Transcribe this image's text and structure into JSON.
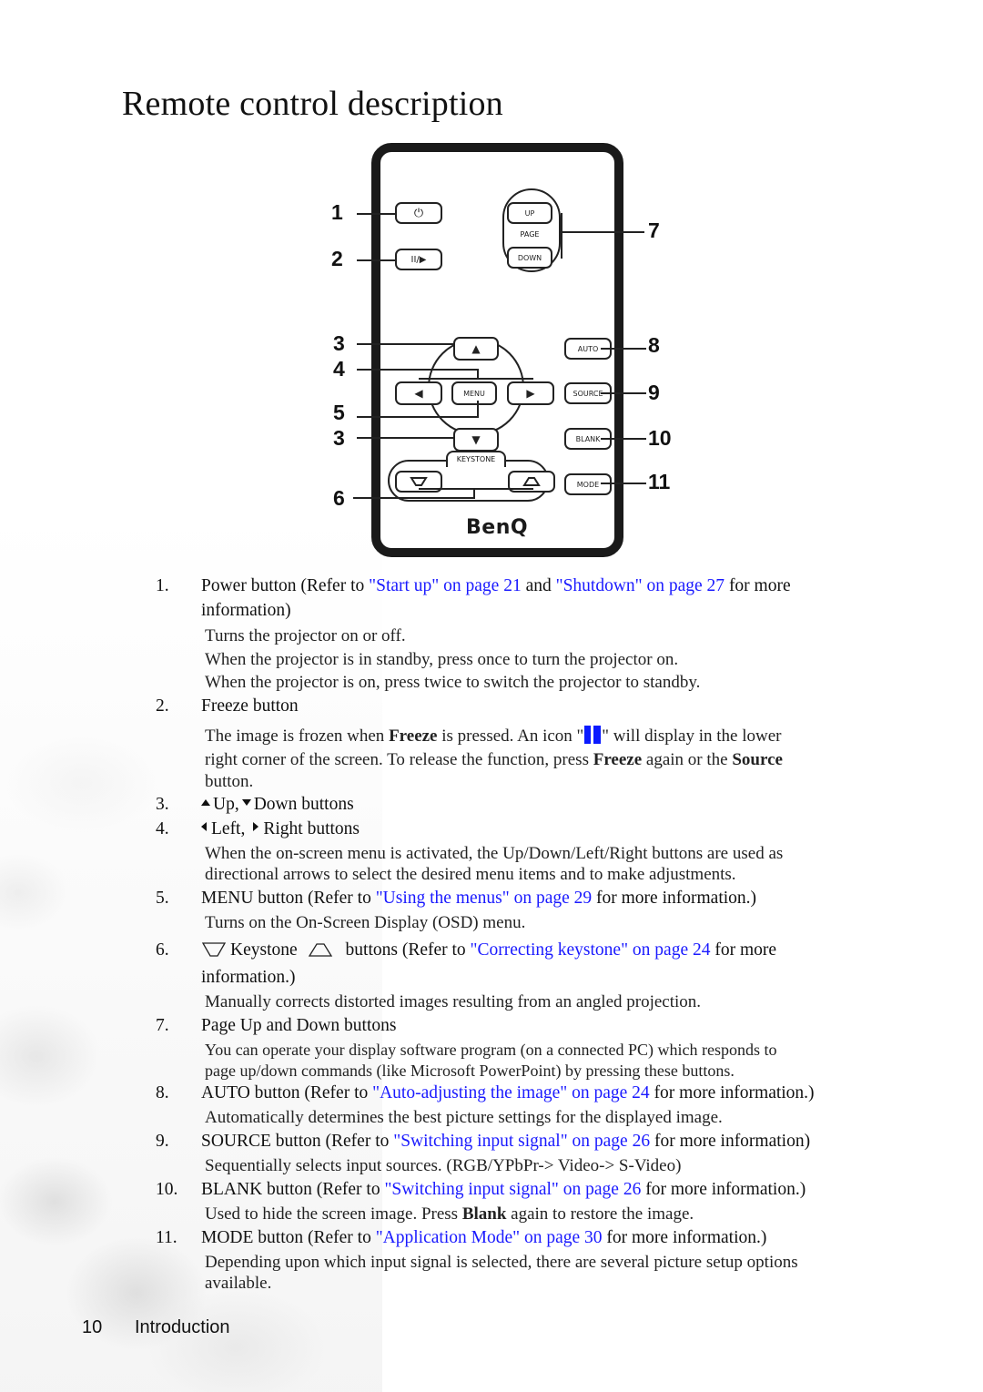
{
  "page": {
    "title": "Remote control description",
    "footer": {
      "page_number": "10",
      "section": "Introduction"
    }
  },
  "remote": {
    "brand": "BenQ",
    "buttons": {
      "power": "⏻",
      "freeze": "II/▶",
      "page_up": "UP",
      "page_label": "PAGE",
      "page_down": "DOWN",
      "up": "▲",
      "down": "▼",
      "left": "◀",
      "right": "▶",
      "menu": "MENU",
      "auto": "AUTO",
      "source": "SOURCE",
      "blank": "BLANK",
      "mode": "MODE",
      "keystone_label": "KEYSTONE"
    },
    "callouts": [
      "1",
      "2",
      "3",
      "4",
      "5",
      "3",
      "6",
      "7",
      "8",
      "9",
      "10",
      "11"
    ]
  },
  "items": [
    {
      "num": "1.",
      "title_pre": "Power button  (Refer to ",
      "link1": "\"Start up\" on page 21",
      "mid": " and ",
      "link2": "\"Shutdown\" on page 27",
      "title_post": " for more",
      "title_cont": "information)",
      "lines": [
        "Turns the projector on or off.",
        "When the projector is in standby, press once to turn the projector on.",
        "When the projector is on, press twice to switch the projector to standby."
      ]
    },
    {
      "num": "2.",
      "title": "Freeze button",
      "line1_pre": "The image is frozen when ",
      "line1_bold": "Freeze",
      "line1_mid": " is pressed. An icon \"",
      "line1_post": "\" will display in the lower",
      "line2_pre": "right corner of the screen. To release the function, press ",
      "line2_bold1": "Freeze",
      "line2_mid": " again or the ",
      "line2_bold2": "Source",
      "line3": "button."
    },
    {
      "num": "3.",
      "up": "Up,",
      "down": "Down buttons"
    },
    {
      "num": "4.",
      "left": "Left,",
      "right": "Right buttons",
      "lines": [
        "When the on-screen menu is activated, the Up/Down/Left/Right buttons are used as",
        "directional arrows to select the desired menu items and to make adjustments."
      ]
    },
    {
      "num": "5.",
      "title_pre": "MENU button (Refer to ",
      "link": "\"Using the menus\" on page 29",
      "title_post": " for more information.)",
      "lines": [
        "Turns on the On-Screen Display (OSD) menu."
      ]
    },
    {
      "num": "6.",
      "keystone": "Keystone",
      "title_pre": "buttons (Refer to ",
      "link": "\"Correcting keystone\" on page 24",
      "title_post": " for more",
      "title_cont": "information.)",
      "lines": [
        "Manually corrects distorted images resulting from an angled projection."
      ]
    },
    {
      "num": "7.",
      "title": "Page Up and Down buttons",
      "lines": [
        "You can operate your display software program (on a connected PC) which responds to",
        "page up/down commands (like Microsoft PowerPoint) by pressing these buttons."
      ]
    },
    {
      "num": "8.",
      "title_pre": "AUTO button (Refer to ",
      "link": "\"Auto-adjusting the image\" on page 24",
      "title_post": " for more information.)",
      "lines": [
        "Automatically determines the best picture settings for the displayed image."
      ]
    },
    {
      "num": "9.",
      "title_pre": "SOURCE button (Refer to ",
      "link": "\"Switching input signal\" on page 26",
      "title_post": " for more information)",
      "lines": [
        "Sequentially selects input sources. (RGB/YPbPr-> Video-> S-Video)"
      ]
    },
    {
      "num": "10.",
      "title_pre": "BLANK button (Refer to ",
      "link": "\"Switching input signal\" on page 26",
      "title_post": " for more information.)",
      "line_pre": "Used to hide the screen image. Press ",
      "line_bold": "Blank",
      "line_post": " again to restore the image."
    },
    {
      "num": "11.",
      "title_pre": "MODE button (Refer to ",
      "link": "\"Application Mode\" on page 30",
      "title_post": " for more information.)",
      "lines": [
        "Depending upon which input signal is selected, there are several picture setup options",
        "available."
      ]
    }
  ],
  "colors": {
    "link": "#1a1aff",
    "freeze_icon": "#0a1aff"
  }
}
